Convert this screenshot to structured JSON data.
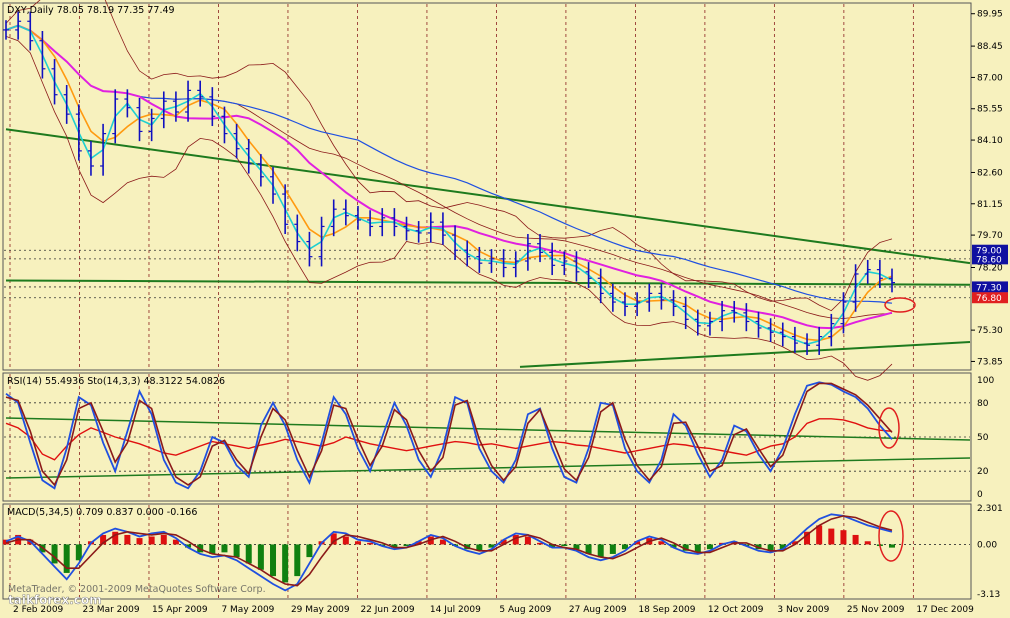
{
  "chart_data": {
    "type": "line",
    "header": "DXY,Daily  78.05 78.19 77.35 77.49",
    "price_axis": {
      "ticks": [
        89.95,
        88.45,
        87.0,
        85.55,
        84.1,
        82.6,
        81.15,
        79.7,
        78.2,
        75.3,
        73.85
      ],
      "highlighted": [
        "79.00",
        "78.60",
        "77.30",
        "76.80"
      ],
      "ylim": [
        73.5,
        90.4
      ]
    },
    "date_labels": [
      "2 Feb 2009",
      "23 Mar 2009",
      "15 Apr 2009",
      "7 May 2009",
      "29 May 2009",
      "22 Jun 2009",
      "14 Jul 2009",
      "5 Aug 2009",
      "27 Aug 2009",
      "18 Sep 2009",
      "12 Oct 2009",
      "3 Nov 2009",
      "25 Nov 2009",
      "17 Dec 2009"
    ],
    "price_close": [
      89.2,
      89.6,
      88.7,
      87.4,
      86.2,
      85.3,
      83.6,
      82.9,
      84.4,
      86.0,
      85.6,
      84.5,
      85.1,
      85.9,
      85.4,
      86.4,
      86.1,
      85.2,
      84.4,
      83.7,
      83.0,
      82.4,
      81.6,
      80.2,
      79.4,
      78.7,
      80.1,
      80.9,
      80.6,
      80.4,
      80.1,
      80.5,
      80.1,
      79.9,
      79.8,
      80.3,
      79.7,
      79.0,
      78.7,
      78.4,
      78.6,
      78.2,
      78.5,
      79.3,
      78.9,
      78.3,
      78.5,
      78.0,
      77.7,
      77.0,
      76.6,
      76.4,
      76.6,
      77.0,
      76.7,
      76.4,
      75.8,
      75.5,
      75.7,
      76.2,
      76.1,
      75.7,
      75.4,
      75.2,
      75.0,
      74.7,
      74.6,
      75.0,
      75.6,
      76.6,
      77.9,
      78.1,
      77.7,
      77.5
    ],
    "price_series": [
      "DXY (bars)",
      "MA fast (cyan)",
      "MA (orange)",
      "MA (magenta)",
      "MA 200 (blue)",
      "Bollinger bands (dark red)"
    ],
    "rsi_panel": {
      "label": "RSI(14) 55.4936  Sto(14,3,3) 48.3122 54.0826",
      "ticks": [
        100,
        80,
        50,
        20,
        0
      ],
      "rsi": [
        62,
        58,
        50,
        35,
        30,
        42,
        52,
        58,
        54,
        50,
        47,
        44,
        40,
        36,
        34,
        38,
        42,
        46,
        44,
        42,
        40,
        43,
        45,
        48,
        46,
        44,
        42,
        45,
        50,
        47,
        44,
        42,
        40,
        38,
        40,
        42,
        44,
        46,
        45,
        43,
        44,
        42,
        40,
        42,
        44,
        46,
        45,
        43,
        42,
        40,
        38,
        36,
        38,
        40,
        42,
        44,
        43,
        41,
        40,
        38,
        36,
        34,
        38,
        42,
        44,
        50,
        62,
        66,
        66,
        65,
        62,
        58,
        56,
        55
      ],
      "stoch_k": [
        88,
        80,
        45,
        12,
        5,
        40,
        85,
        78,
        45,
        20,
        55,
        90,
        70,
        30,
        10,
        5,
        20,
        50,
        45,
        25,
        15,
        60,
        80,
        60,
        30,
        10,
        45,
        85,
        70,
        40,
        20,
        50,
        80,
        60,
        30,
        15,
        40,
        85,
        80,
        40,
        20,
        10,
        30,
        70,
        75,
        40,
        15,
        10,
        40,
        80,
        78,
        40,
        20,
        10,
        30,
        70,
        60,
        35,
        15,
        30,
        60,
        55,
        35,
        20,
        40,
        70,
        95,
        98,
        96,
        90,
        85,
        75,
        60,
        48
      ],
      "stoch_d": [
        85,
        82,
        55,
        20,
        8,
        30,
        75,
        80,
        55,
        28,
        45,
        82,
        75,
        38,
        15,
        8,
        15,
        42,
        47,
        30,
        18,
        50,
        75,
        65,
        38,
        15,
        38,
        78,
        75,
        48,
        25,
        42,
        74,
        65,
        38,
        20,
        32,
        78,
        82,
        48,
        25,
        12,
        24,
        62,
        74,
        48,
        22,
        12,
        32,
        72,
        80,
        48,
        25,
        12,
        24,
        62,
        63,
        42,
        20,
        25,
        52,
        57,
        40,
        24,
        34,
        62,
        90,
        97,
        97,
        92,
        87,
        78,
        66,
        54
      ]
    },
    "macd_panel": {
      "label": "MACD(5,34,5) 0.709 0.837 0.000 -0.166",
      "ticks": [
        "2.301",
        "0.00",
        "-3.13"
      ],
      "ylim": [
        -3.13,
        2.301
      ],
      "hist": [
        0.3,
        0.6,
        0.3,
        -0.5,
        -1.2,
        -1.8,
        -1.0,
        0.2,
        0.6,
        0.8,
        0.6,
        0.4,
        0.5,
        0.6,
        0.3,
        -0.2,
        -0.5,
        -0.6,
        -0.5,
        -0.8,
        -1.2,
        -1.6,
        -2.0,
        -2.4,
        -2.0,
        -0.8,
        0.2,
        0.7,
        0.5,
        0.2,
        0.1,
        -0.1,
        -0.2,
        -0.1,
        0.2,
        0.5,
        0.3,
        -0.1,
        -0.3,
        -0.4,
        -0.2,
        0.3,
        0.6,
        0.5,
        0.1,
        -0.2,
        -0.1,
        -0.3,
        -0.6,
        -0.8,
        -0.6,
        -0.3,
        0.2,
        0.4,
        0.2,
        -0.2,
        -0.4,
        -0.5,
        -0.3,
        0.1,
        0.2,
        -0.1,
        -0.3,
        -0.4,
        -0.3,
        0.2,
        0.8,
        1.2,
        1.0,
        0.9,
        0.6,
        0.2,
        -0.1,
        -0.2
      ],
      "macd": [
        0.2,
        0.5,
        0.2,
        -0.6,
        -1.4,
        -2.2,
        -1.2,
        0.1,
        0.7,
        1.0,
        0.8,
        0.5,
        0.7,
        0.8,
        0.4,
        -0.2,
        -0.6,
        -0.8,
        -0.7,
        -1.0,
        -1.5,
        -2.0,
        -2.5,
        -2.9,
        -2.5,
        -1.2,
        0.1,
        0.8,
        0.7,
        0.3,
        0.2,
        -0.1,
        -0.3,
        -0.2,
        0.2,
        0.6,
        0.4,
        -0.1,
        -0.4,
        -0.6,
        -0.3,
        0.3,
        0.7,
        0.6,
        0.2,
        -0.2,
        -0.2,
        -0.4,
        -0.8,
        -1.0,
        -0.8,
        -0.4,
        0.2,
        0.5,
        0.3,
        -0.2,
        -0.5,
        -0.6,
        -0.4,
        0.0,
        0.2,
        -0.1,
        -0.4,
        -0.5,
        -0.3,
        0.3,
        1.0,
        1.6,
        1.9,
        1.8,
        1.5,
        1.2,
        1.0,
        0.8
      ],
      "signal": [
        0.1,
        0.3,
        0.3,
        -0.2,
        -0.8,
        -1.5,
        -1.5,
        -0.7,
        0.1,
        0.6,
        0.8,
        0.7,
        0.6,
        0.7,
        0.6,
        0.2,
        -0.3,
        -0.6,
        -0.7,
        -0.8,
        -1.2,
        -1.6,
        -2.1,
        -2.5,
        -2.6,
        -1.9,
        -0.8,
        0.2,
        0.6,
        0.5,
        0.3,
        0.1,
        -0.2,
        -0.2,
        0.0,
        0.3,
        0.5,
        0.2,
        -0.2,
        -0.4,
        -0.4,
        0.0,
        0.4,
        0.6,
        0.4,
        0.0,
        -0.2,
        -0.3,
        -0.6,
        -0.8,
        -0.9,
        -0.6,
        -0.2,
        0.2,
        0.4,
        0.1,
        -0.3,
        -0.5,
        -0.5,
        -0.2,
        0.1,
        0.1,
        -0.2,
        -0.4,
        -0.4,
        0.0,
        0.6,
        1.2,
        1.6,
        1.8,
        1.7,
        1.4,
        1.1,
        0.9
      ]
    },
    "watermark": "MetaTrader, © 2001-2009 MetaQuotes Software Corp.",
    "logo_text": "taikforex.com",
    "colors": {
      "background": "#F7F1BE",
      "bars": "#1010C0",
      "grid": "#8B2020",
      "trendline": "#1E7A1E",
      "ma_fast": "#20D0D0",
      "ma_orange": "#FF9A10",
      "ma_magenta": "#E020E0",
      "ma_blue": "#2050E0",
      "band": "#8B1A1A",
      "rsi": "#E01010",
      "macd_hist_up": "#DD1010",
      "macd_hist_down": "#108010",
      "circle": "#E02020"
    }
  }
}
